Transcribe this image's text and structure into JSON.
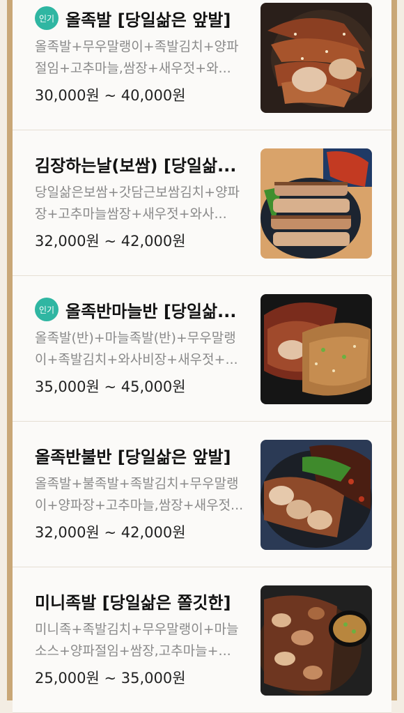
{
  "menu_items": [
    {
      "badge": "인기",
      "title": "올족발 [당일삶은 앞발]",
      "desc": "올족발+무우말랭이+족발김치+양파절임+고추마늘,쌈장+새우젓+와...",
      "price": "30,000원 ~ 40,000원"
    },
    {
      "badge": "",
      "title": "김장하는날(보쌈) [당일삶...",
      "desc": "당일삶은보쌈+갓담근보쌈김치+양파장+고추마늘쌈장+새우젓+와사...",
      "price": "32,000원 ~ 42,000원"
    },
    {
      "badge": "인기",
      "title": "올족반마늘반 [당일삶...",
      "desc": "올족발(반)+마늘족발(반)+무우말랭이+족발김치+와사비장+새우젓+...",
      "price": "35,000원 ~ 45,000원"
    },
    {
      "badge": "",
      "title": "올족반불반 [당일삶은 앞발]",
      "desc": "올족발+불족발+족발김치+무우말랭이+양파장+고추마늘,쌈장+새우젓...",
      "price": "32,000원 ~ 42,000원"
    },
    {
      "badge": "",
      "title": "미니족발 [당일삶은 쫄깃한]",
      "desc": "미니족+족발김치+무우말랭이+마늘소스+양파절임+쌈장,고추마늘+...",
      "price": "25,000원 ~ 35,000원"
    }
  ]
}
